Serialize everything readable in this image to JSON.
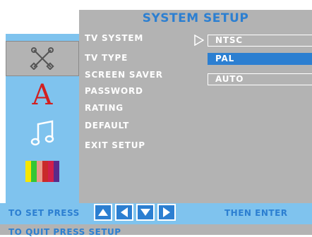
{
  "header": {
    "title": "SYSTEM SETUP"
  },
  "sidebar": {
    "icons": [
      "tools-icon",
      "font-letter-a-icon",
      "music-note-icon",
      "color-bars-icon"
    ],
    "selected_index": 0,
    "letter": "A"
  },
  "menu": {
    "items": [
      {
        "label": "TV SYSTEM"
      },
      {
        "label": "TV TYPE"
      },
      {
        "label": "SCREEN SAVER"
      },
      {
        "label": "PASSWORD"
      },
      {
        "label": "RATING"
      },
      {
        "label": "DEFAULT"
      },
      {
        "label": "EXIT SETUP"
      }
    ]
  },
  "options": {
    "items": [
      {
        "label": "NTSC",
        "selected": false
      },
      {
        "label": "PAL",
        "selected": true
      },
      {
        "label": "AUTO",
        "selected": false
      }
    ]
  },
  "footer": {
    "set_text": "TO SET PRESS",
    "then_text": "THEN ENTER",
    "quit_text": "TO QUIT PRESS SETUP",
    "nav_buttons": [
      "arrow-up-icon",
      "arrow-left-icon",
      "arrow-down-icon",
      "arrow-right-icon"
    ]
  },
  "colors": {
    "accent": "#2c7fd1",
    "panel": "#b3b3b3",
    "sidebar": "#7fc3ee",
    "text": "#ffffff"
  }
}
